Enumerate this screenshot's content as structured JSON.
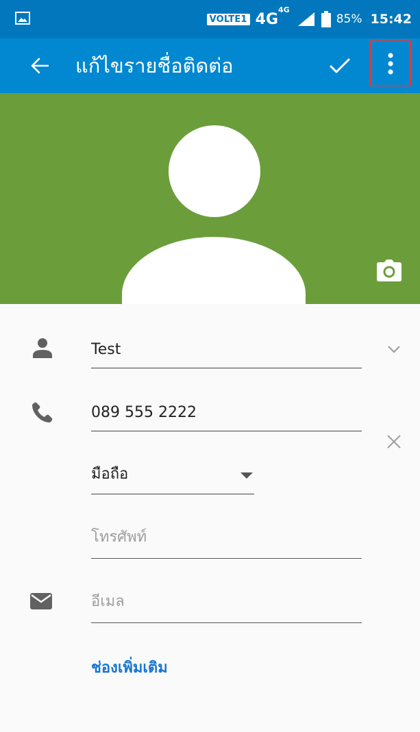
{
  "status_bar": {
    "volte": "VOLTE1",
    "network": "4G",
    "network_sup": "4G",
    "battery_percent": "85%",
    "time": "15:42",
    "left_icon": "gallery-notification-icon"
  },
  "app_bar": {
    "title": "แก้ไขรายชื่อติดต่อ",
    "back_icon": "arrow-back-icon",
    "save_icon": "check-icon",
    "more_icon": "more-vert-icon"
  },
  "photo": {
    "background_color": "#6b9e3b",
    "camera_icon": "camera-icon"
  },
  "form": {
    "name": {
      "value": "Test",
      "icon": "person-icon",
      "expand_icon": "chevron-down-icon"
    },
    "phone": {
      "value": "089 555 2222",
      "icon": "phone-icon",
      "remove_icon": "close-icon"
    },
    "phone_type": {
      "value": "มือถือ"
    },
    "phone_empty": {
      "placeholder": "โทรศัพท์"
    },
    "email": {
      "placeholder": "อีเมล",
      "icon": "email-icon"
    },
    "more_fields_label": "ช่องเพิ่มเติม"
  },
  "colors": {
    "status_bar": "#0277bd",
    "app_bar": "#0288d1",
    "accent": "#1976d2",
    "highlight": "#e53935"
  }
}
